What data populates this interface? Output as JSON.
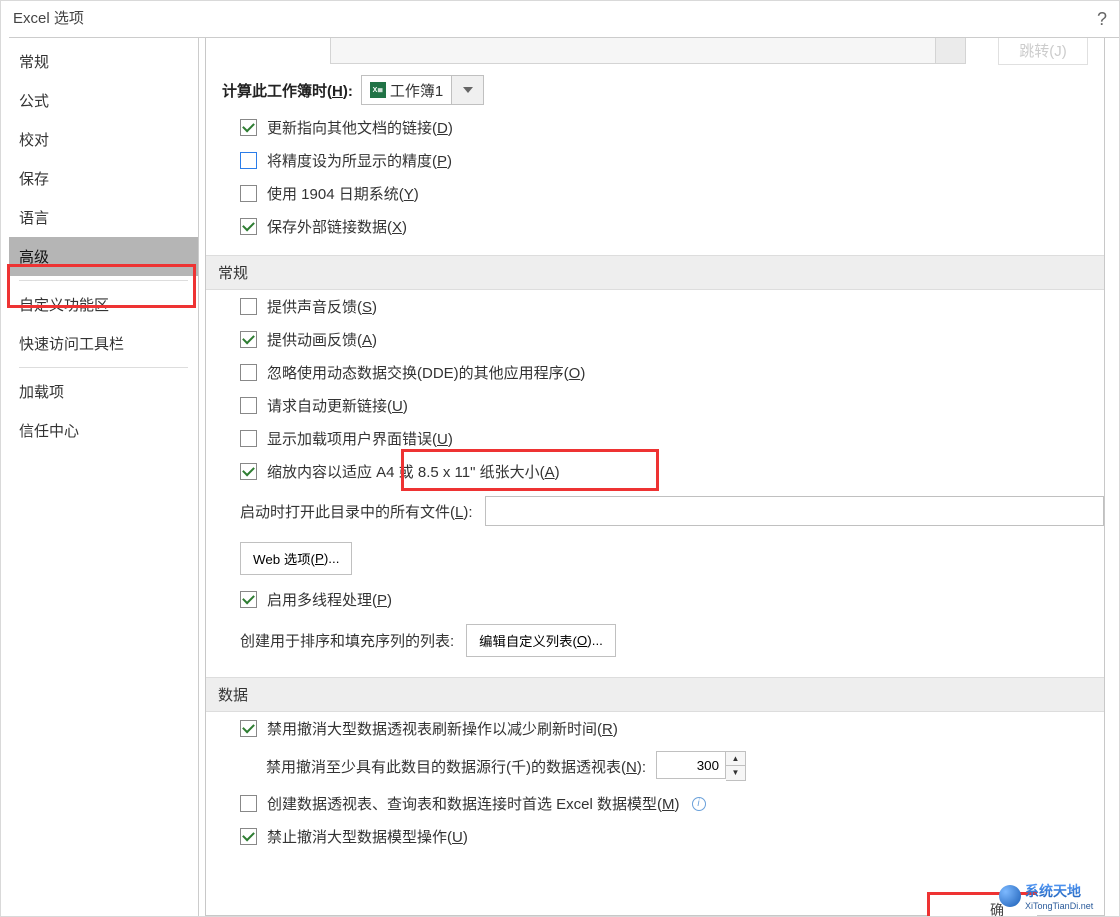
{
  "window": {
    "title": "Excel 选项",
    "help": "?"
  },
  "sidebar": {
    "items": [
      {
        "label": "常规"
      },
      {
        "label": "公式"
      },
      {
        "label": "校对"
      },
      {
        "label": "保存"
      },
      {
        "label": "语言"
      },
      {
        "label": "高级",
        "selected": true
      },
      {
        "label": "自定义功能区"
      },
      {
        "label": "快速访问工具栏"
      },
      {
        "label": "加载项"
      },
      {
        "label": "信任中心"
      }
    ]
  },
  "topcut": {
    "greyed_button": "跳转(J)"
  },
  "workbook_calc": {
    "label_prefix": "计算此工作簿时(",
    "label_u": "H",
    "label_suffix": "):",
    "workbook_name": "工作簿1",
    "options": [
      {
        "checked": true,
        "text_prefix": "更新指向其他文档的链接(",
        "u": "D",
        "text_suffix": ")"
      },
      {
        "checked": false,
        "blue": true,
        "text_prefix": "将精度设为所显示的精度(",
        "u": "P",
        "text_suffix": ")"
      },
      {
        "checked": false,
        "text_prefix": "使用 1904 日期系统(",
        "u": "Y",
        "text_suffix": ")"
      },
      {
        "checked": true,
        "text_prefix": "保存外部链接数据(",
        "u": "X",
        "text_suffix": ")"
      }
    ]
  },
  "general": {
    "header": "常规",
    "options": [
      {
        "checked": false,
        "text_prefix": "提供声音反馈(",
        "u": "S",
        "text_suffix": ")"
      },
      {
        "checked": true,
        "text_prefix": "提供动画反馈(",
        "u": "A",
        "text_suffix": ")"
      },
      {
        "checked": false,
        "text_prefix": "忽略使用动态数据交换(DDE)的其他应用程序(",
        "u": "O",
        "text_suffix": ")"
      },
      {
        "checked": false,
        "text_prefix": "请求自动更新链接(",
        "u": "U",
        "text_suffix": ")",
        "highlighted": true
      },
      {
        "checked": false,
        "text_prefix": "显示加载项用户界面错误(",
        "u": "U",
        "text_suffix": ")"
      },
      {
        "checked": true,
        "text_prefix": "缩放内容以适应 A4 或 8.5 x 11\" 纸张大小(",
        "u": "A",
        "text_suffix": ")"
      }
    ],
    "startup_label_prefix": "启动时打开此目录中的所有文件(",
    "startup_u": "L",
    "startup_label_suffix": "):",
    "startup_value": "",
    "web_button_prefix": "Web 选项(",
    "web_u": "P",
    "web_button_suffix": ")...",
    "multithread": {
      "checked": true,
      "text_prefix": "启用多线程处理(",
      "u": "P",
      "text_suffix": ")"
    },
    "sortlist_label": "创建用于排序和填充序列的列表:",
    "sortlist_button_prefix": "编辑自定义列表(",
    "sortlist_u": "O",
    "sortlist_button_suffix": ")..."
  },
  "data": {
    "header": "数据",
    "options": [
      {
        "checked": true,
        "text_prefix": "禁用撤消大型数据透视表刷新操作以减少刷新时间(",
        "u": "R",
        "text_suffix": ")"
      }
    ],
    "undo_row_label_prefix": "禁用撤消至少具有此数目的数据源行(千)的数据透视表(",
    "undo_u": "N",
    "undo_row_label_suffix": "):",
    "undo_value": "300",
    "datamodel": {
      "checked": false,
      "text_prefix": "创建数据透视表、查询表和数据连接时首选 Excel 数据模型(",
      "u": "M",
      "text_suffix": ")",
      "info": true
    },
    "disallow_undo": {
      "checked": true,
      "text_prefix": "禁止撤消大型数据模型操作(",
      "u": "U",
      "text_suffix": ")"
    }
  },
  "footer": {
    "ok_partial": "确"
  },
  "watermark": {
    "line1": "系统天地",
    "line2": "XiTongTianDi.net"
  }
}
